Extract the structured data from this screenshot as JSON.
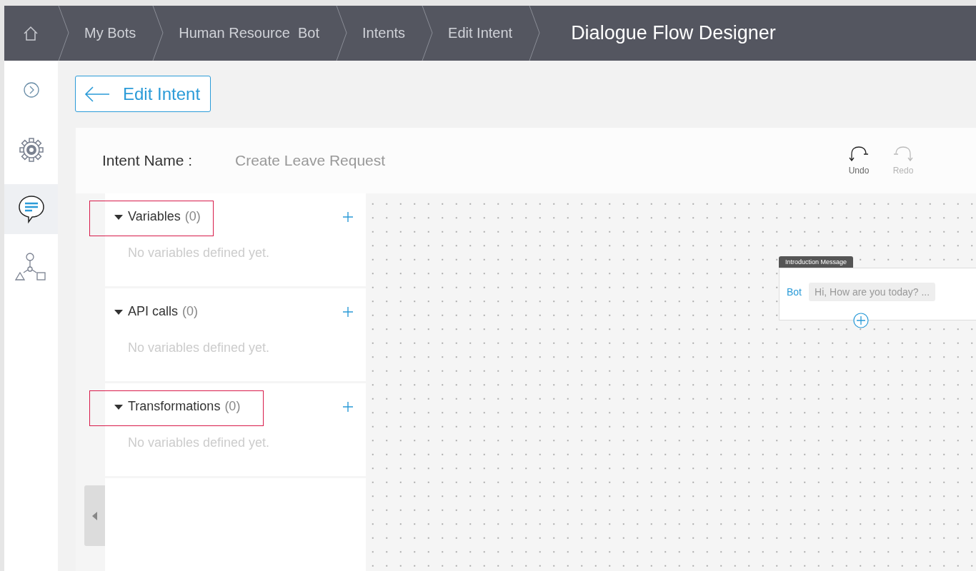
{
  "breadcrumbs": [
    {
      "label": "My Bots",
      "kind": "link"
    },
    {
      "label": "Human Resource  Bot",
      "kind": "link"
    },
    {
      "label": "Intents",
      "kind": "link"
    },
    {
      "label": "Edit Intent",
      "kind": "link"
    },
    {
      "label": "Dialogue Flow Designer",
      "kind": "current"
    }
  ],
  "sidebar": {
    "items": [
      {
        "kind": "expand",
        "selected": false
      },
      {
        "kind": "settings",
        "selected": false
      },
      {
        "kind": "dialogue",
        "selected": true
      },
      {
        "kind": "flow",
        "selected": false
      }
    ]
  },
  "back_button": {
    "label": "Edit Intent"
  },
  "intent": {
    "label": "Intent Name :",
    "value": "Create Leave Request"
  },
  "toolbar": [
    {
      "kind": "undo",
      "label": "Undo",
      "disabled": false
    },
    {
      "kind": "redo",
      "label": "Redo",
      "disabled": true
    }
  ],
  "sections": [
    {
      "title": "Variables",
      "count": "(0)",
      "empty_text": "No variables defined yet.",
      "expanded": true,
      "highlighted": true
    },
    {
      "title": "API calls",
      "count": "(0)",
      "empty_text": "No variables defined yet.",
      "expanded": true,
      "highlighted": false
    },
    {
      "title": "Transformations",
      "count": "(0)",
      "empty_text": "No variables defined yet.",
      "expanded": true,
      "highlighted": true
    }
  ],
  "canvas": {
    "node": {
      "title": "Introduction Message",
      "speaker": "Bot",
      "message": "Hi, How are you today? ..."
    }
  }
}
